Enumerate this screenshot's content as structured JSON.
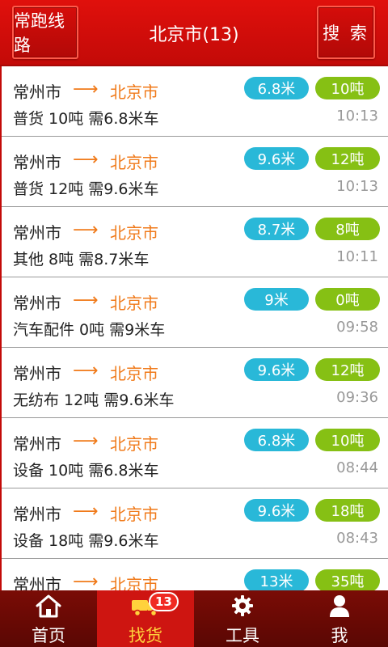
{
  "header": {
    "left_button": "常跑线路",
    "title": "北京市(13)",
    "right_button": "搜 索"
  },
  "list": [
    {
      "from": "常州市",
      "arrow": "⟶",
      "to": "北京市",
      "length": "6.8米",
      "weight": "10吨",
      "desc": "普货 10吨 需6.8米车",
      "time": "10:13"
    },
    {
      "from": "常州市",
      "arrow": "⟶",
      "to": "北京市",
      "length": "9.6米",
      "weight": "12吨",
      "desc": "普货 12吨 需9.6米车",
      "time": "10:13"
    },
    {
      "from": "常州市",
      "arrow": "⟶",
      "to": "北京市",
      "length": "8.7米",
      "weight": "8吨",
      "desc": "其他 8吨 需8.7米车",
      "time": "10:11"
    },
    {
      "from": "常州市",
      "arrow": "⟶",
      "to": "北京市",
      "length": "9米",
      "weight": "0吨",
      "desc": "汽车配件 0吨 需9米车",
      "time": "09:58"
    },
    {
      "from": "常州市",
      "arrow": "⟶",
      "to": "北京市",
      "length": "9.6米",
      "weight": "12吨",
      "desc": "无纺布 12吨 需9.6米车",
      "time": "09:36"
    },
    {
      "from": "常州市",
      "arrow": "⟶",
      "to": "北京市",
      "length": "6.8米",
      "weight": "10吨",
      "desc": "设备 10吨 需6.8米车",
      "time": "08:44"
    },
    {
      "from": "常州市",
      "arrow": "⟶",
      "to": "北京市",
      "length": "9.6米",
      "weight": "18吨",
      "desc": "设备 18吨 需9.6米车",
      "time": "08:43"
    },
    {
      "from": "常州市",
      "arrow": "⟶",
      "to": "北京市",
      "length": "13米",
      "weight": "35吨",
      "desc": "",
      "time": ""
    }
  ],
  "nav": {
    "home": "首页",
    "find_goods": "找货",
    "find_goods_badge": "13",
    "tools": "工具",
    "me": "我"
  },
  "colors": {
    "header_red": "#d20e0b",
    "destination_orange": "#f07a1a",
    "length_tag": "#29b8d8",
    "weight_tag": "#86c014",
    "nav_active": "#ce1511",
    "nav_active_text": "#ffd23c",
    "nav_bg": "#6a0904"
  },
  "icons": {
    "home": "home-icon",
    "find_goods": "truck-icon",
    "tools": "gear-icon",
    "me": "person-icon"
  }
}
